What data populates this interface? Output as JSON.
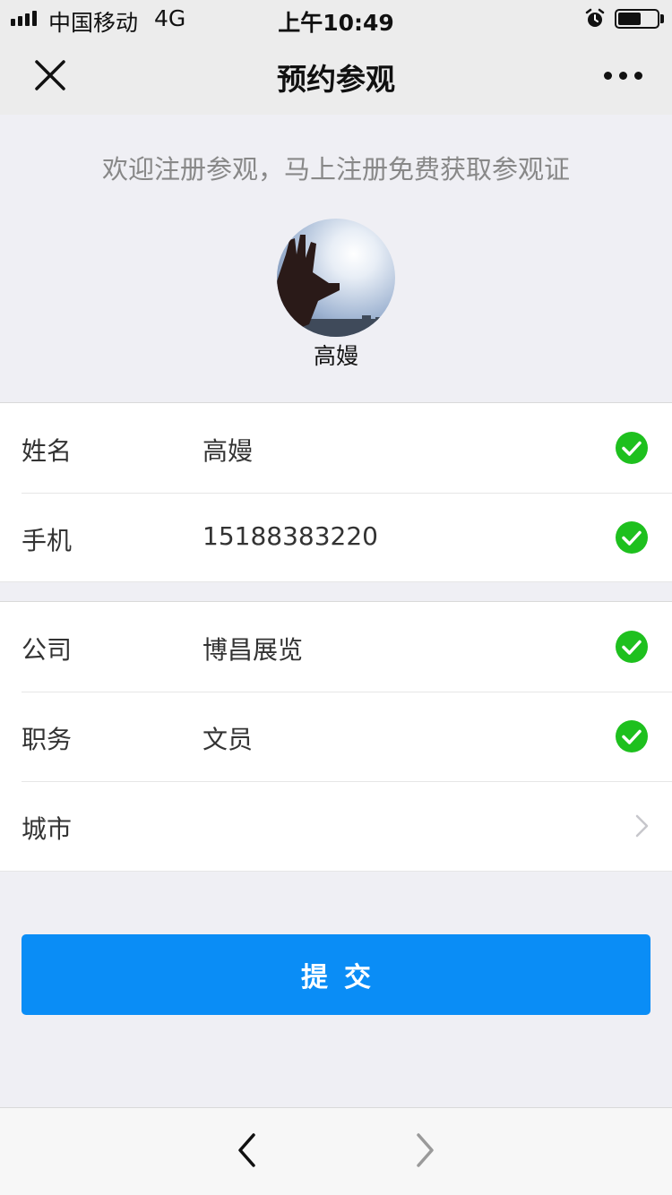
{
  "status_bar": {
    "carrier": "中国移动",
    "network": "4G",
    "time": "上午10:49",
    "battery_level": 0.6
  },
  "nav": {
    "title": "预约参观",
    "close_icon": "close-icon",
    "more_icon": "more-icon"
  },
  "header": {
    "welcome_text": "欢迎注册参观，马上注册免费获取参观证",
    "avatar_name": "高嫚"
  },
  "form": {
    "group1": [
      {
        "label": "姓名",
        "value": "高嫚",
        "status": "check-icon"
      },
      {
        "label": "手机",
        "value": "15188383220",
        "status": "check-icon"
      }
    ],
    "group2": [
      {
        "label": "公司",
        "value": "博昌展览",
        "status": "check-icon"
      },
      {
        "label": "职务",
        "value": "文员",
        "status": "check-icon"
      },
      {
        "label": "城市",
        "value": "",
        "status": "chevron-right-icon"
      }
    ]
  },
  "submit_label": "提交",
  "toolbar": {
    "back_icon": "back-arrow-icon",
    "forward_icon": "forward-arrow-icon"
  },
  "colors": {
    "accent": "#0a8df6",
    "success": "#1ec01e",
    "background": "#efeff4"
  }
}
